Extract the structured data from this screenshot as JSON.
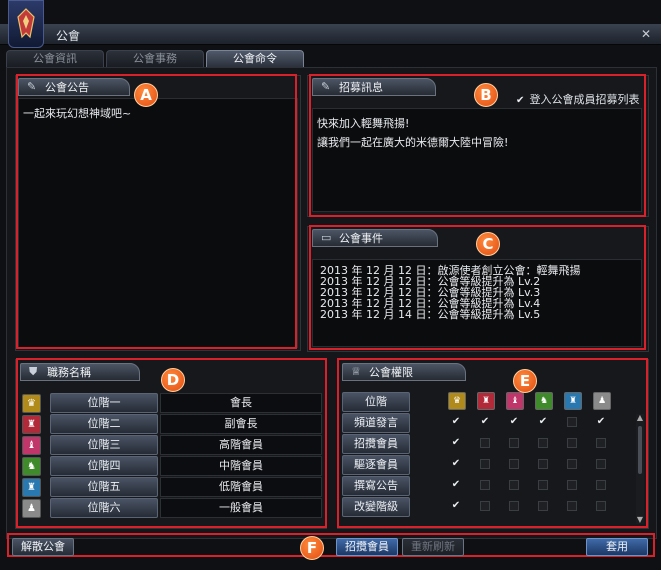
{
  "window": {
    "title": "公會",
    "close": "✕"
  },
  "tabs": [
    "公會資訊",
    "公會事務",
    "公會命令"
  ],
  "active_tab": 2,
  "announcement": {
    "header": "公會公告",
    "text": "一起來玩幻想神域吧~"
  },
  "recruit": {
    "header": "招募訊息",
    "checkbox_label": "登入公會成員招募列表",
    "checked": true,
    "lines": [
      "快來加入輕舞飛揚!",
      "讓我們一起在廣大的米德爾大陸中冒險!"
    ]
  },
  "events": {
    "header": "公會事件",
    "lines": [
      "2013 年 12 月 12 日：啟源使者創立公會：輕舞飛揚",
      "2013 年 12 月 12 日：公會等級提升為 Lv.2",
      "2013 年 12 月 12 日：公會等級提升為 Lv.3",
      "2013 年 12 月 12 日：公會等級提升為 Lv.4",
      "2013 年 12 月 14 日：公會等級提升為 Lv.5"
    ]
  },
  "ranks": {
    "header": "職務名稱",
    "items": [
      {
        "rank": "位階一",
        "title": "會長",
        "color": "#b08a1a"
      },
      {
        "rank": "位階二",
        "title": "副會長",
        "color": "#b02a3a"
      },
      {
        "rank": "位階三",
        "title": "高階會員",
        "color": "#c0366a"
      },
      {
        "rank": "位階四",
        "title": "中階會員",
        "color": "#3f8a2a"
      },
      {
        "rank": "位階五",
        "title": "低階會員",
        "color": "#2a78b0"
      },
      {
        "rank": "位階六",
        "title": "一般會員",
        "color": "#8a8a8a"
      }
    ]
  },
  "permissions": {
    "header": "公會權限",
    "rank_label": "位階",
    "rank_colors": [
      "#b08a1a",
      "#b02a3a",
      "#c0366a",
      "#3f8a2a",
      "#2a78b0",
      "#8a8a8a"
    ],
    "rows": [
      {
        "label": "頻道發言",
        "values": [
          true,
          true,
          true,
          true,
          false,
          true
        ]
      },
      {
        "label": "招攬會員",
        "values": [
          true,
          false,
          false,
          false,
          false,
          false
        ]
      },
      {
        "label": "驅逐會員",
        "values": [
          true,
          false,
          false,
          false,
          false,
          false
        ]
      },
      {
        "label": "撰寫公告",
        "values": [
          true,
          false,
          false,
          false,
          false,
          false
        ]
      },
      {
        "label": "改變階級",
        "values": [
          true,
          false,
          false,
          false,
          false,
          false
        ]
      }
    ]
  },
  "footer": {
    "disband": "解散公會",
    "recruit": "招攬會員",
    "disabled_btn": "重新刷新",
    "apply": "套用"
  },
  "labels": {
    "A": "A",
    "B": "B",
    "C": "C",
    "D": "D",
    "E": "E",
    "F": "F"
  }
}
